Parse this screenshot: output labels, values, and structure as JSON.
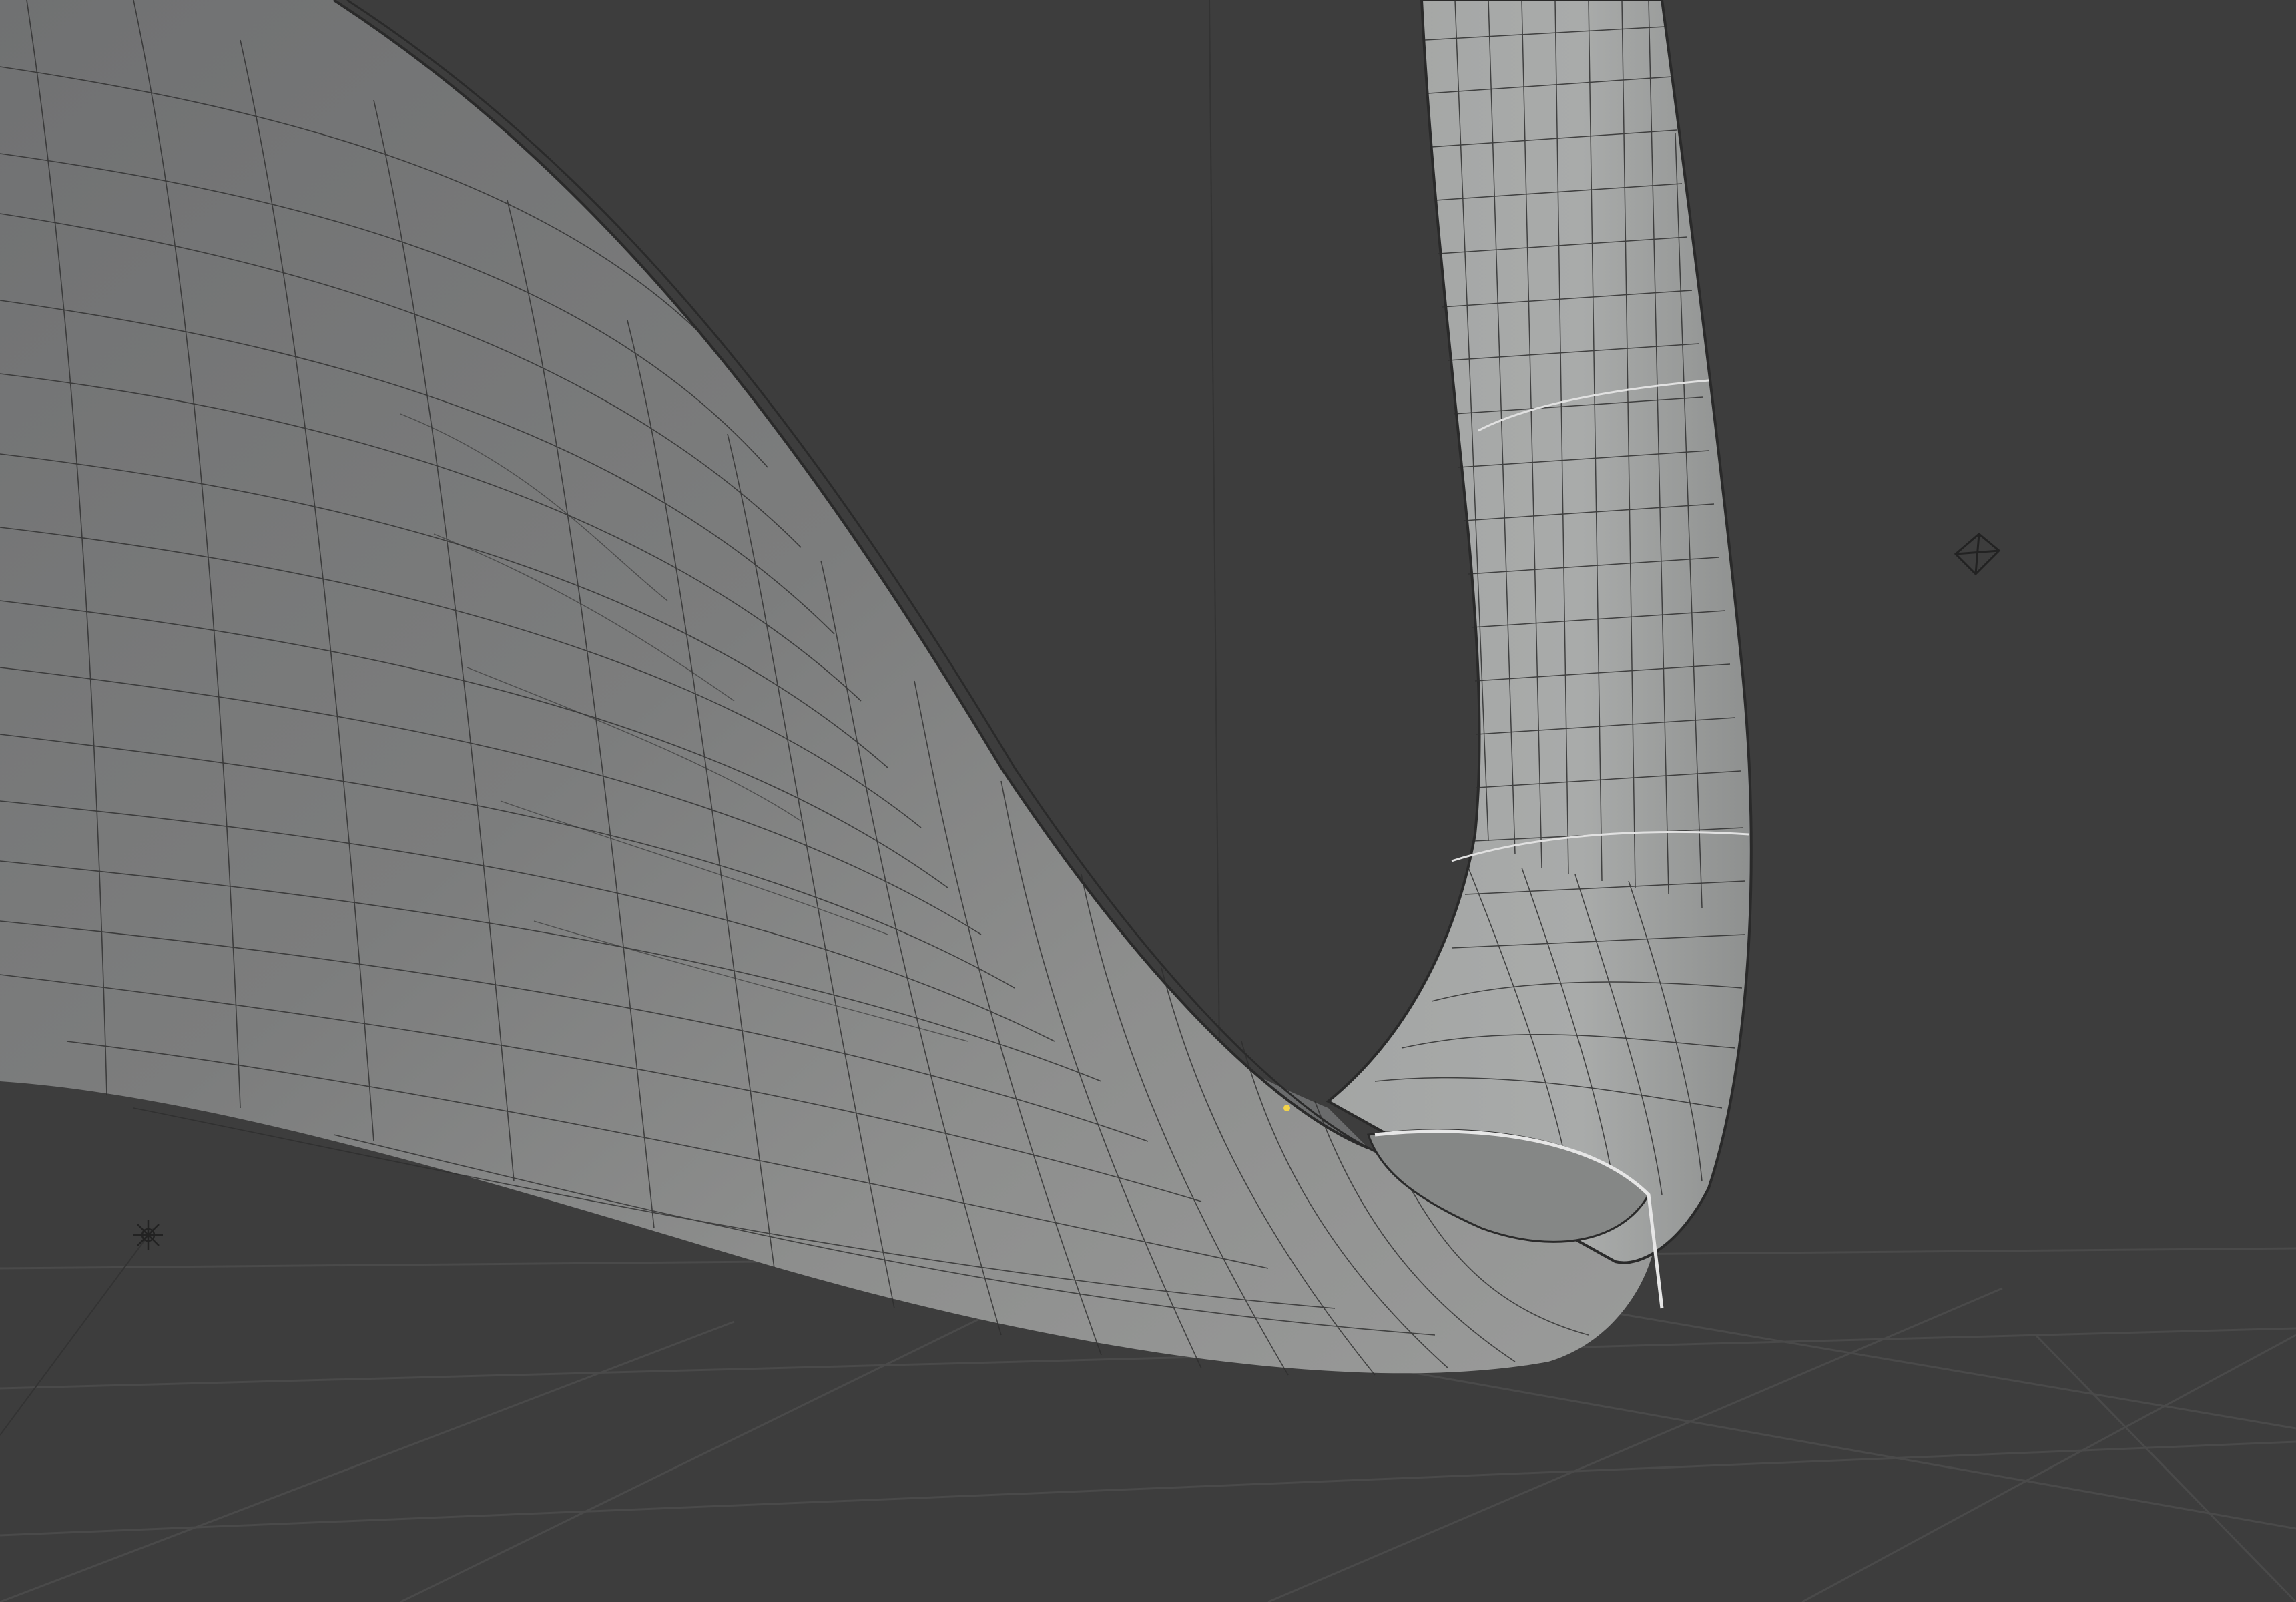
{
  "viewport": {
    "background": "#3d3d3d",
    "grid_color": "#4a4a4a",
    "mesh_face_color": "#8f9190",
    "mesh_dark_color": "#5a5b5c",
    "mesh_light_color": "#a7a9a8",
    "wire_color": "#2a2a2a",
    "highlight_edge_color": "#e6e6e6",
    "vertex_marker_color": "#f2d34a"
  },
  "objects": [
    {
      "name": "ribbon-surface",
      "type": "mesh"
    },
    {
      "name": "tube-surface",
      "type": "mesh"
    },
    {
      "name": "camera-gizmo",
      "icon": "camera-icon"
    },
    {
      "name": "light-gizmo",
      "icon": "light-icon"
    }
  ]
}
